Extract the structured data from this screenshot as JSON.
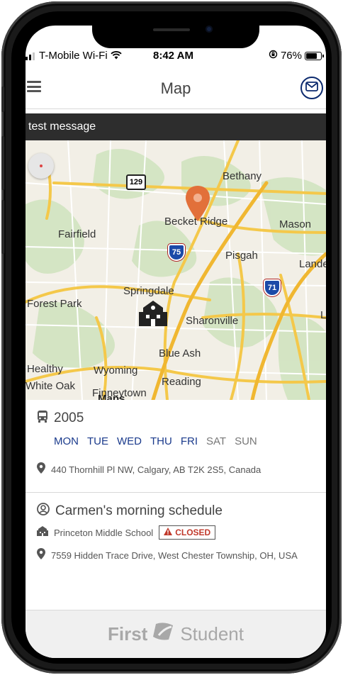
{
  "status_bar": {
    "carrier": "T-Mobile Wi-Fi",
    "time": "8:42 AM",
    "battery": "76%",
    "battery_level": 0.76
  },
  "header": {
    "title": "Map"
  },
  "banner": {
    "message": "test message"
  },
  "map": {
    "labels": [
      "Bethany",
      "Becket Ridge",
      "Mason",
      "Fairfield",
      "Pisgah",
      "Lande",
      "Springdale",
      "Forest Park",
      "Sharonville",
      "Blue Ash",
      "Healthy",
      "Wyoming",
      "White Oak",
      "Reading",
      "Finneytown",
      "L"
    ],
    "shields": [
      "129",
      "75",
      "71"
    ],
    "attribution": "Maps"
  },
  "route_card": {
    "bus_number": "2005",
    "days_active": [
      "MON",
      "TUE",
      "WED",
      "THU",
      "FRI"
    ],
    "days_inactive": [
      "SAT",
      "SUN"
    ],
    "address": "440 Thornhill Pl NW, Calgary, AB T2K 2S5, Canada"
  },
  "schedule_card": {
    "title": "Carmen's morning schedule",
    "school": "Princeton Middle School",
    "status": "CLOSED",
    "address": "7559 Hidden Trace Drive, West Chester Township, OH, USA"
  },
  "footer": {
    "brand_first": "First",
    "brand_second": "Student"
  },
  "colors": {
    "accent": "#1a3a8c",
    "banner_bg": "#2d2d2d",
    "closed": "#c0392b",
    "pin": "#e2703a"
  }
}
